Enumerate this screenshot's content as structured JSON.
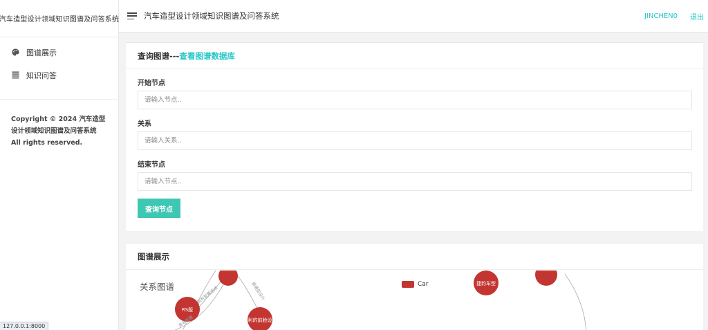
{
  "sidebar": {
    "logo": "汽车造型设计领域知识图谱及问答系统",
    "items": [
      {
        "label": "图谱展示",
        "icon": "palette-icon"
      },
      {
        "label": "知识问答",
        "icon": "list-icon"
      }
    ],
    "copyright": "Copyright © 2024 汽车造型设计领域知识图谱及问答系统 All rights reserved."
  },
  "header": {
    "title": "汽车造型设计领域知识图谱及问答系统",
    "user": "JINCHEN0",
    "logout": "退出"
  },
  "query": {
    "title_prefix": "查询图谱---",
    "title_link": "查看图谱数据库",
    "start_label": "开始节点",
    "start_placeholder": "请输入节点..",
    "rel_label": "关系",
    "rel_placeholder": "请输入关系..",
    "end_label": "结束节点",
    "end_placeholder": "请输入节点..",
    "button": "查询节点"
  },
  "graph": {
    "section_title": "图谱展示",
    "chart_title": "关系图谱",
    "legend": "Car",
    "node_color": "#c23531",
    "nodes": [
      "RS版",
      "利的前脸设",
      "捷豹车型"
    ],
    "edges": [
      "具有配置选项",
      "具有配置",
      "普通型设计"
    ]
  },
  "status": {
    "url": "127.0.0.1:8000"
  }
}
